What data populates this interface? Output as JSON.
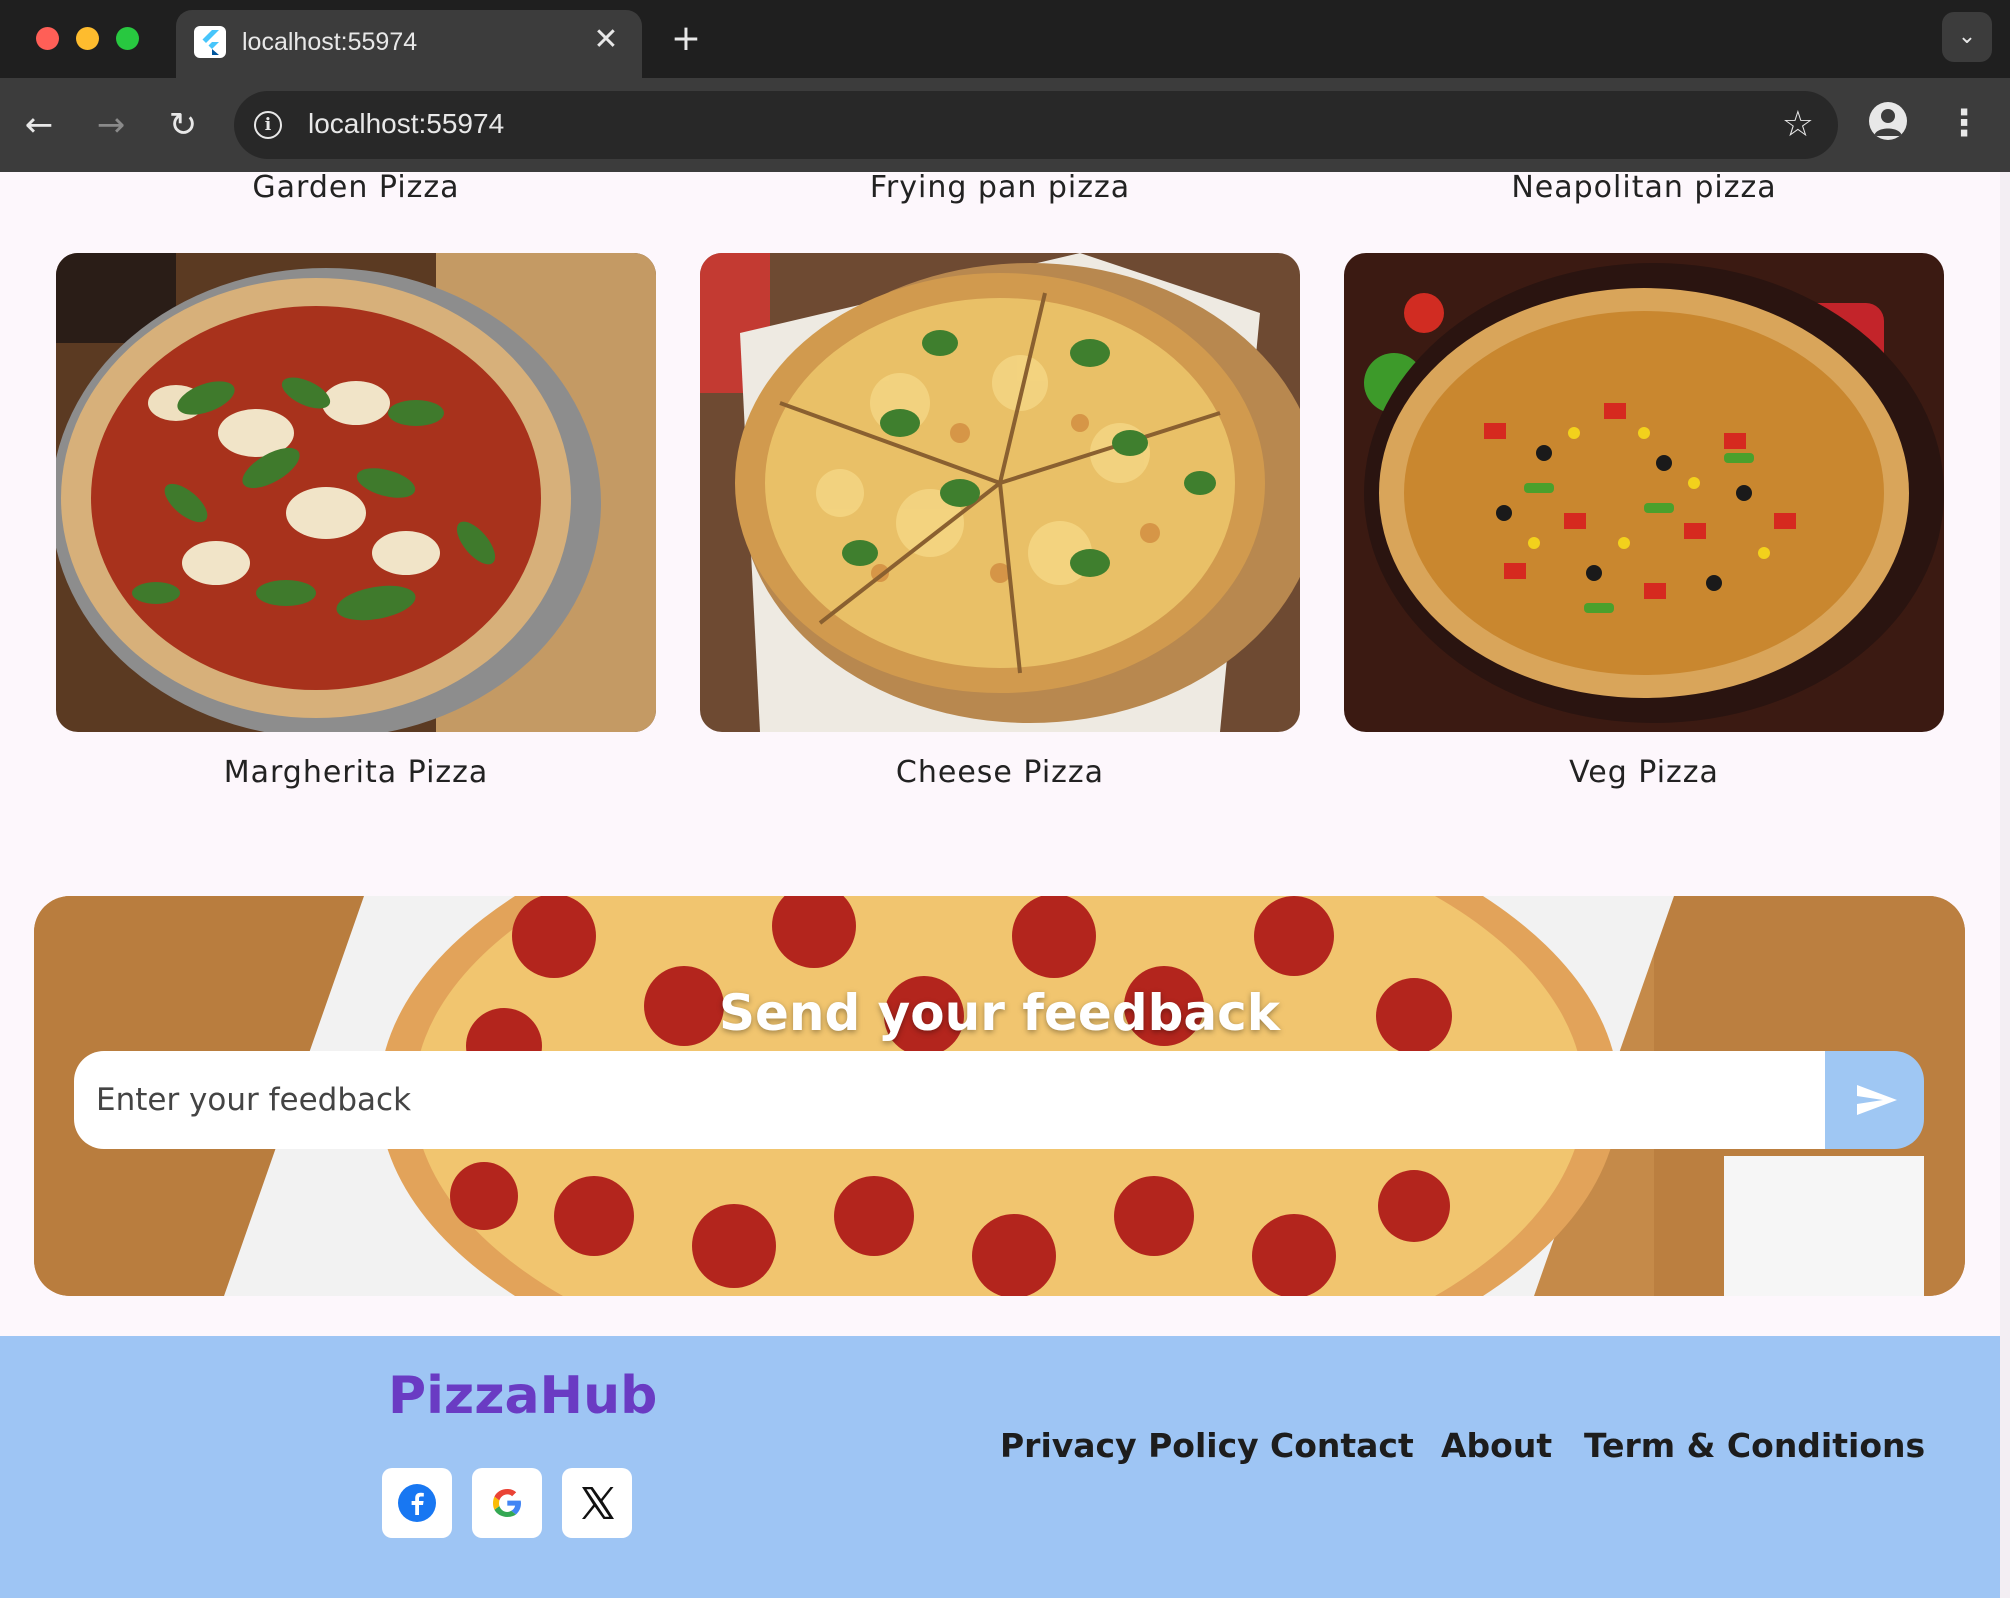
{
  "browser": {
    "tab_title": "localhost:55974",
    "url": "localhost:55974",
    "icons": [
      "close-icon",
      "plus-icon",
      "chevron-down-icon",
      "back-arrow-icon",
      "forward-arrow-icon",
      "reload-icon",
      "info-icon",
      "star-icon",
      "profile-icon",
      "kebab-menu-icon"
    ]
  },
  "menu": {
    "top_row_labels": [
      "Garden Pizza",
      "Frying pan pizza",
      "Neapolitan pizza"
    ],
    "items": [
      {
        "label": "Margherita Pizza"
      },
      {
        "label": "Cheese Pizza"
      },
      {
        "label": "Veg Pizza"
      }
    ]
  },
  "feedback": {
    "title": "Send your feedback",
    "placeholder": "Enter your feedback",
    "send_icon": "send-icon"
  },
  "footer": {
    "brand": "PizzaHub",
    "brand_color": "#6a3bc3",
    "background_color": "#9ec5f4",
    "social": [
      "facebook-icon",
      "google-icon",
      "x-icon"
    ],
    "links": [
      "Privacy Policy",
      "Contact",
      "About",
      "Term & Conditions"
    ]
  }
}
